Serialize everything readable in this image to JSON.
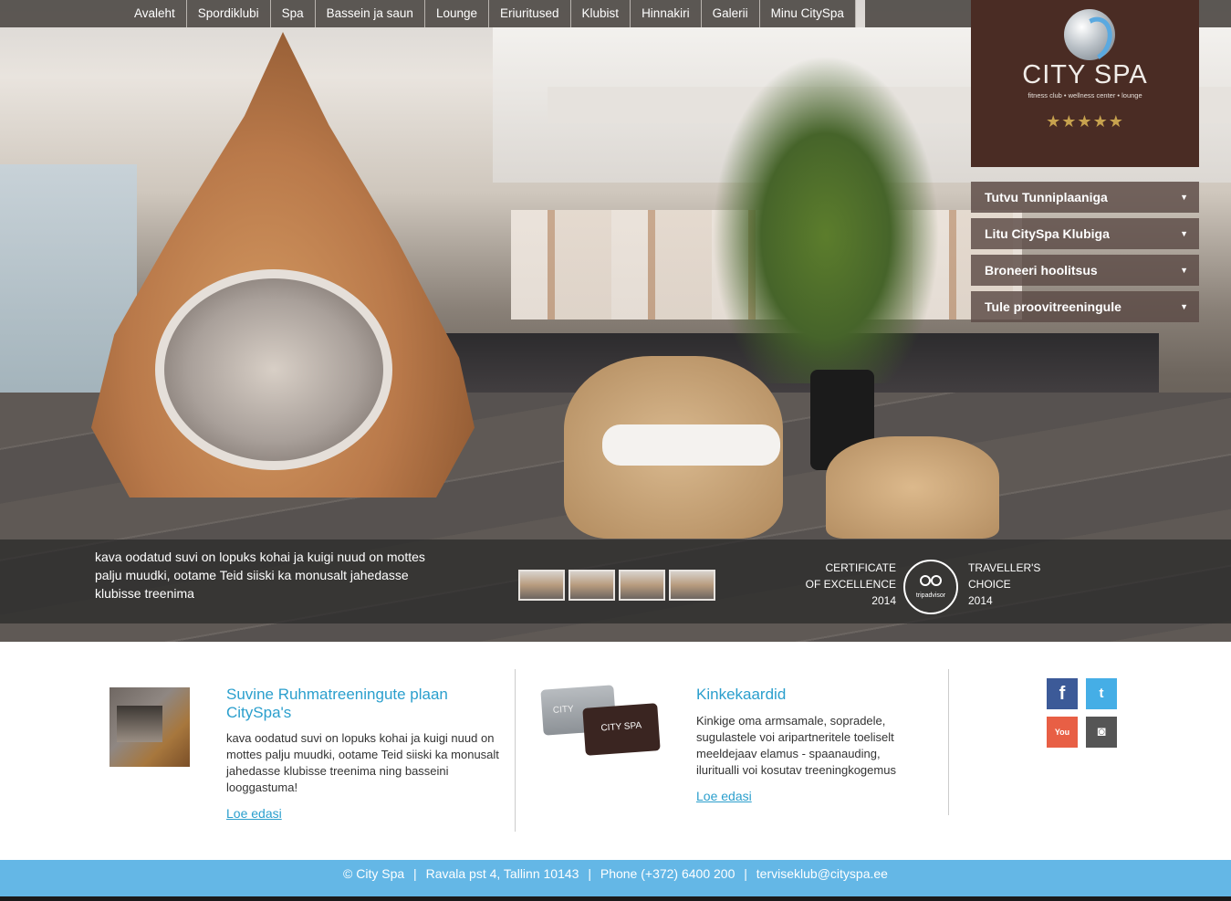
{
  "nav": {
    "items": [
      "Avaleht",
      "Spordiklubi",
      "Spa",
      "Bassein ja saun",
      "Lounge",
      "Eriuritused",
      "Klubist",
      "Hinnakiri",
      "Galerii",
      "Minu CitySpa"
    ]
  },
  "logo": {
    "title": "CITY SPA",
    "subtitle": "fitness club • wellness center • lounge",
    "stars": "★★★★★"
  },
  "side_menu": {
    "items": [
      "Tutvu Tunniplaaniga",
      "Litu CitySpa Klubiga",
      "Broneeri hoolitsus",
      "Tule proovitreeningule"
    ]
  },
  "caption": {
    "text": "kava oodatud suvi on lopuks kohai ja kuigi nuud on mottes palju muudki, ootame Teid siiski ka monusalt jahedasse klubisse treenima"
  },
  "certificate": {
    "left_line1": "CERTIFICATE",
    "left_line2": "OF EXCELLENCE",
    "left_year": "2014",
    "badge": "tripadvisor",
    "right_line1": "TRAVELLER'S",
    "right_line2": "CHOICE",
    "right_year": "2014"
  },
  "news": {
    "title": "Suvine Ruhmatreeningute plaan CitySpa's",
    "body": "kava oodatud suvi on lopuks kohai ja kuigi nuud on mottes palju muudki, ootame Teid siiski ka monusalt jahedasse klubisse treenima ning basseini looggastuma!",
    "link": "Loe edasi"
  },
  "gift": {
    "card_back": "CITY",
    "card_front": "CITY SPA",
    "title": "Kinkekaardid",
    "body": "Kinkige oma armsamale, sopradele, sugulastele voi aripartneritele toeliselt meeldejaav elamus - spaanauding, iluritualli voi kosutav treeningkogemus",
    "link": "Loe edasi"
  },
  "social": {
    "facebook": "f",
    "twitter": "t",
    "youtube": "You Tube",
    "instagram": "◙"
  },
  "footer": {
    "copyright": "© City Spa",
    "address": "Ravala pst 4, Tallinn 10143",
    "phone": "Phone (+372) 6400 200",
    "email": "terviseklub@cityspa.ee"
  },
  "colors": {
    "accent": "#2b9fcd",
    "logo_bg": "#4a2c24",
    "footer_bg": "#64b7e6"
  }
}
